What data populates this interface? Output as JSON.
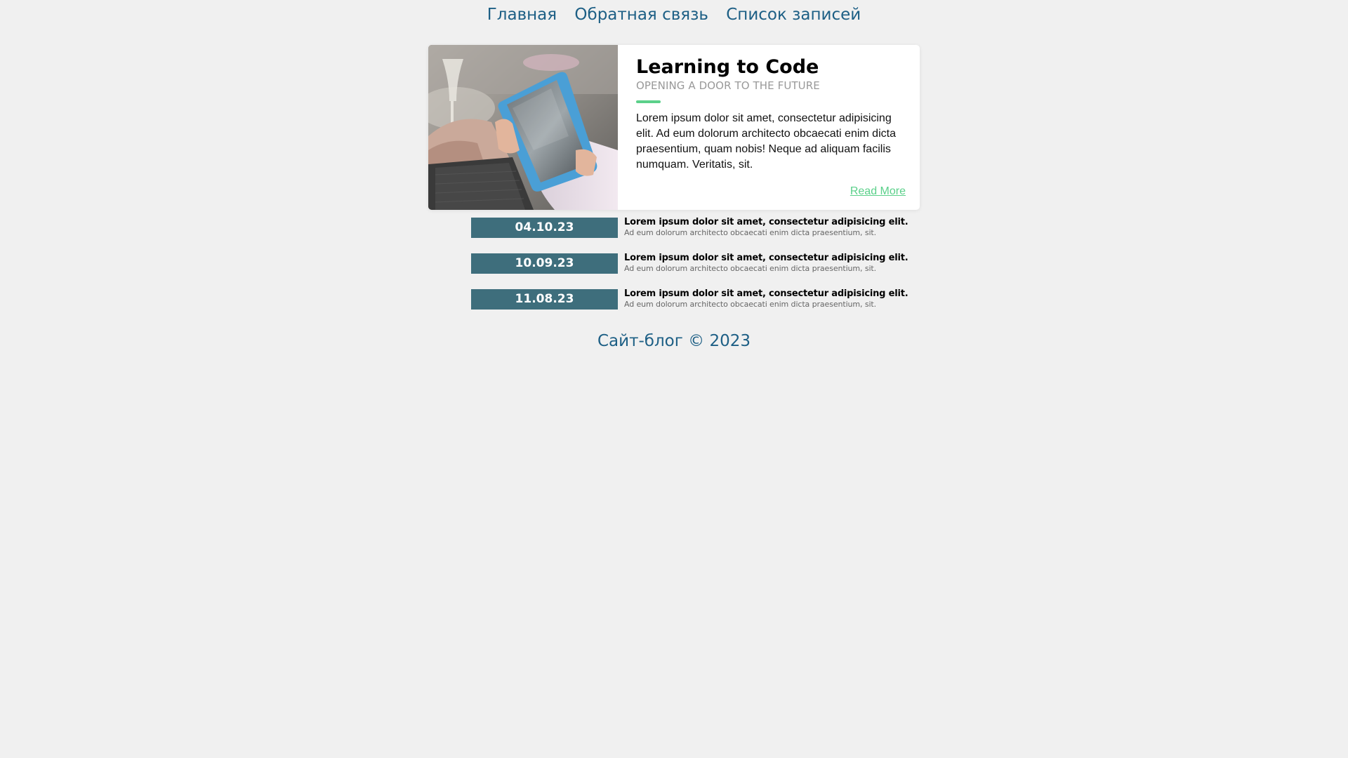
{
  "nav": {
    "items": [
      {
        "label": "Главная"
      },
      {
        "label": "Обратная связь"
      },
      {
        "label": "Список записей"
      }
    ],
    "color": "#1d5f85"
  },
  "featured": {
    "image": "photo of a person holding a tablet",
    "title": "Learning to Code",
    "subtitle": "OPENING A DOOR TO THE FUTURE",
    "text": "Lorem ipsum dolor sit amet, consectetur adipisicing elit. Ad eum dolorum architecto obcaecati enim dicta praesentium, quam nobis! Neque ad aliquam facilis numquam. Veritatis, sit.",
    "link_label": "Read More",
    "accent_color": "#5bd08a"
  },
  "posts": [
    {
      "date": "04.10.23",
      "title": "Lorem ipsum dolor sit amet, consectetur adipisicing elit.",
      "excerpt": "Ad eum dolorum architecto obcaecati enim dicta praesentium, sit."
    },
    {
      "date": "10.09.23",
      "title": "Lorem ipsum dolor sit amet, consectetur adipisicing elit.",
      "excerpt": "Ad eum dolorum architecto obcaecati enim dicta praesentium, sit."
    },
    {
      "date": "11.08.23",
      "title": "Lorem ipsum dolor sit amet, consectetur adipisicing elit.",
      "excerpt": "Ad eum dolorum architecto obcaecati enim dicta praesentium, sit."
    }
  ],
  "date_badge_color": "#3e6e7c",
  "footer": {
    "text": "Сайт-блог © 2023"
  }
}
